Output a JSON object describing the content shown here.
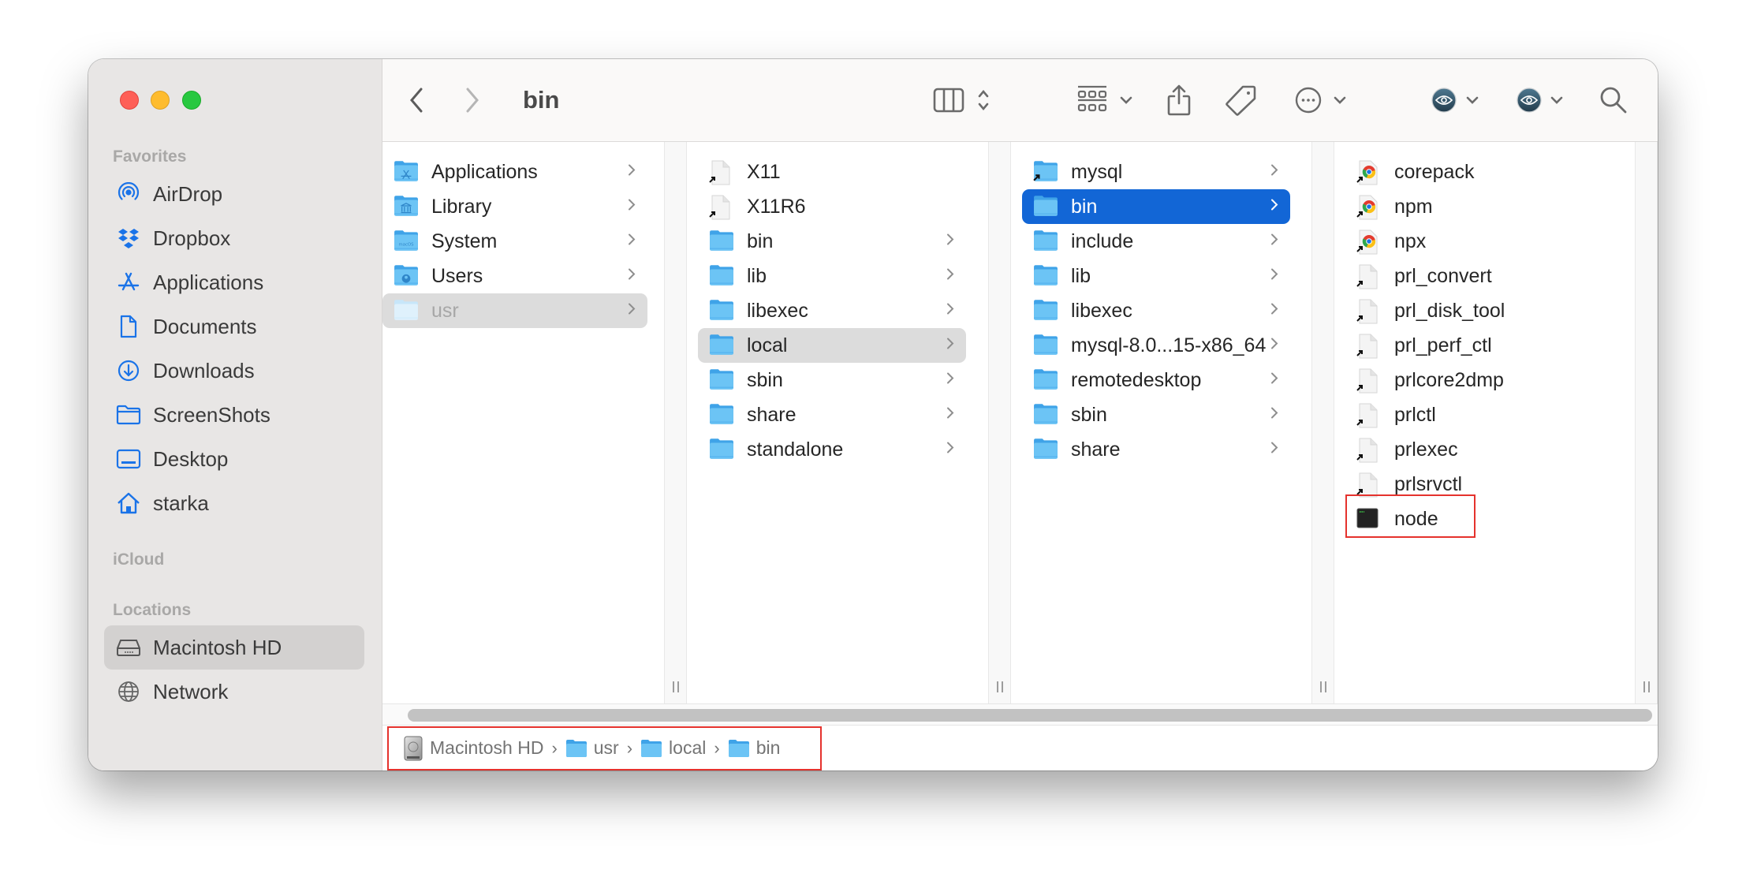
{
  "window": {
    "title": "bin",
    "traffic_lights": [
      "close",
      "minimize",
      "zoom"
    ]
  },
  "toolbar": {
    "back_icon": "chevron-left-icon",
    "forward_icon": "chevron-right-icon",
    "title": "bin",
    "buttons": [
      {
        "name": "view-columns",
        "icon": "columns-icon"
      },
      {
        "name": "group",
        "icon": "group-grid-icon"
      },
      {
        "name": "share",
        "icon": "share-icon"
      },
      {
        "name": "tags",
        "icon": "tag-icon"
      },
      {
        "name": "more-actions",
        "icon": "ellipsis-circle-icon"
      },
      {
        "name": "extension-1",
        "icon": "eye-icon"
      },
      {
        "name": "extension-2",
        "icon": "eye-icon"
      },
      {
        "name": "search",
        "icon": "search-icon"
      }
    ]
  },
  "sidebar": {
    "sections": {
      "favorites": "Favorites",
      "icloud": "iCloud",
      "locations": "Locations"
    },
    "favorites": [
      {
        "label": "AirDrop",
        "icon": "airdrop-icon"
      },
      {
        "label": "Dropbox",
        "icon": "dropbox-icon"
      },
      {
        "label": "Applications",
        "icon": "applications-icon"
      },
      {
        "label": "Documents",
        "icon": "document-icon"
      },
      {
        "label": "Downloads",
        "icon": "download-icon"
      },
      {
        "label": "ScreenShots",
        "icon": "folder-icon"
      },
      {
        "label": "Desktop",
        "icon": "desktop-icon"
      },
      {
        "label": "starka",
        "icon": "home-icon"
      }
    ],
    "locations": [
      {
        "label": "Macintosh HD",
        "icon": "hard-drive-icon",
        "selected": true
      },
      {
        "label": "Network",
        "icon": "globe-icon"
      }
    ]
  },
  "columns": [
    {
      "items": [
        {
          "name": "Applications",
          "type": "folder",
          "badge": "apps",
          "has_children": true
        },
        {
          "name": "Library",
          "type": "folder",
          "badge": "library",
          "has_children": true
        },
        {
          "name": "System",
          "type": "folder",
          "badge": "macos",
          "has_children": true
        },
        {
          "name": "Users",
          "type": "folder",
          "badge": "user",
          "has_children": true
        },
        {
          "name": "usr",
          "type": "folder",
          "hidden": true,
          "selected": "inactive",
          "has_children": true
        }
      ]
    },
    {
      "items": [
        {
          "name": "X11",
          "type": "alias"
        },
        {
          "name": "X11R6",
          "type": "alias"
        },
        {
          "name": "bin",
          "type": "folder",
          "has_children": true
        },
        {
          "name": "lib",
          "type": "folder",
          "has_children": true
        },
        {
          "name": "libexec",
          "type": "folder",
          "has_children": true
        },
        {
          "name": "local",
          "type": "folder",
          "selected": "inactive",
          "has_children": true
        },
        {
          "name": "sbin",
          "type": "folder",
          "has_children": true
        },
        {
          "name": "share",
          "type": "folder",
          "has_children": true
        },
        {
          "name": "standalone",
          "type": "folder",
          "has_children": true
        }
      ]
    },
    {
      "items": [
        {
          "name": "mysql",
          "type": "folder-alias",
          "has_children": true
        },
        {
          "name": "bin",
          "type": "folder",
          "selected": "active",
          "has_children": true
        },
        {
          "name": "include",
          "type": "folder",
          "has_children": true
        },
        {
          "name": "lib",
          "type": "folder",
          "has_children": true
        },
        {
          "name": "libexec",
          "type": "folder",
          "has_children": true
        },
        {
          "name": "mysql-8.0...15-x86_64",
          "type": "folder",
          "has_children": true
        },
        {
          "name": "remotedesktop",
          "type": "folder",
          "has_children": true
        },
        {
          "name": "sbin",
          "type": "folder",
          "has_children": true
        },
        {
          "name": "share",
          "type": "folder",
          "has_children": true
        }
      ]
    },
    {
      "items": [
        {
          "name": "corepack",
          "type": "chrome-alias"
        },
        {
          "name": "npm",
          "type": "chrome-alias"
        },
        {
          "name": "npx",
          "type": "chrome-alias"
        },
        {
          "name": "prl_convert",
          "type": "alias"
        },
        {
          "name": "prl_disk_tool",
          "type": "alias"
        },
        {
          "name": "prl_perf_ctl",
          "type": "alias"
        },
        {
          "name": "prlcore2dmp",
          "type": "alias"
        },
        {
          "name": "prlctl",
          "type": "alias"
        },
        {
          "name": "prlexec",
          "type": "alias"
        },
        {
          "name": "prlsrvctl",
          "type": "alias"
        },
        {
          "name": "node",
          "type": "executable",
          "annotated": true
        }
      ]
    }
  ],
  "path_bar": [
    {
      "label": "Macintosh HD",
      "icon": "hard-drive-icon"
    },
    {
      "label": "usr",
      "icon": "folder-icon"
    },
    {
      "label": "local",
      "icon": "folder-icon"
    },
    {
      "label": "bin",
      "icon": "folder-icon"
    }
  ],
  "colors": {
    "selection_active": "#1266d6",
    "selection_inactive": "#dcdcdc",
    "sidebar_accent": "#1a73e8",
    "annotation_red": "#e5322d",
    "folder_blue": "#6cc4f5"
  }
}
